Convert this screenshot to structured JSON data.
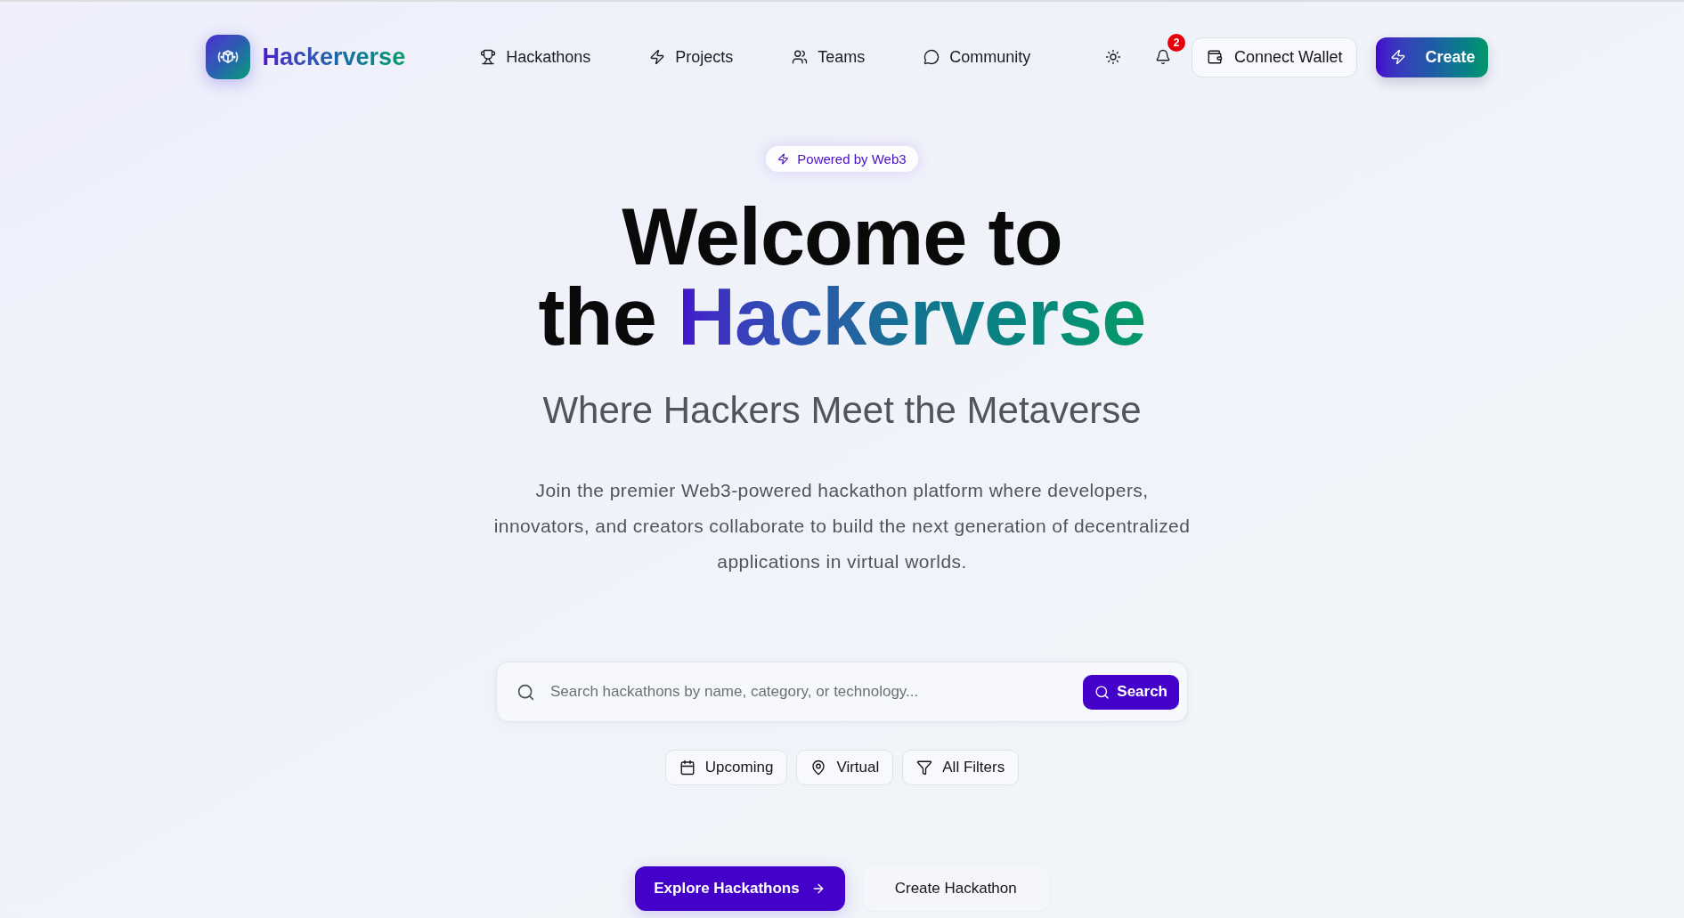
{
  "header": {
    "logo": {
      "text": "Hackerverse"
    },
    "nav": [
      {
        "label": "Hackathons"
      },
      {
        "label": "Projects"
      },
      {
        "label": "Teams"
      },
      {
        "label": "Community"
      }
    ],
    "notifications": {
      "count": "2"
    },
    "connect_wallet": "Connect Wallet",
    "create": "Create"
  },
  "hero": {
    "badge": "Powered by Web3",
    "heading": {
      "text": "Welcome to the",
      "highlight": "Hackerverse"
    },
    "subtitle": "Where Hackers Meet the Metaverse",
    "description": "Join the premier Web3-powered hackathon platform where developers, innovators, and creators collaborate to build the next generation of decentralized applications in virtual worlds.",
    "search": {
      "placeholder": "Search hackathons by name, category, or technology...",
      "button": "Search"
    },
    "filters": [
      {
        "label": "Upcoming"
      },
      {
        "label": "Virtual"
      },
      {
        "label": "All Filters"
      }
    ],
    "actions": [
      {
        "label": "Explore Hackathons",
        "kind": "primary"
      },
      {
        "label": "Create Hackathon",
        "kind": "secondary"
      }
    ]
  }
}
